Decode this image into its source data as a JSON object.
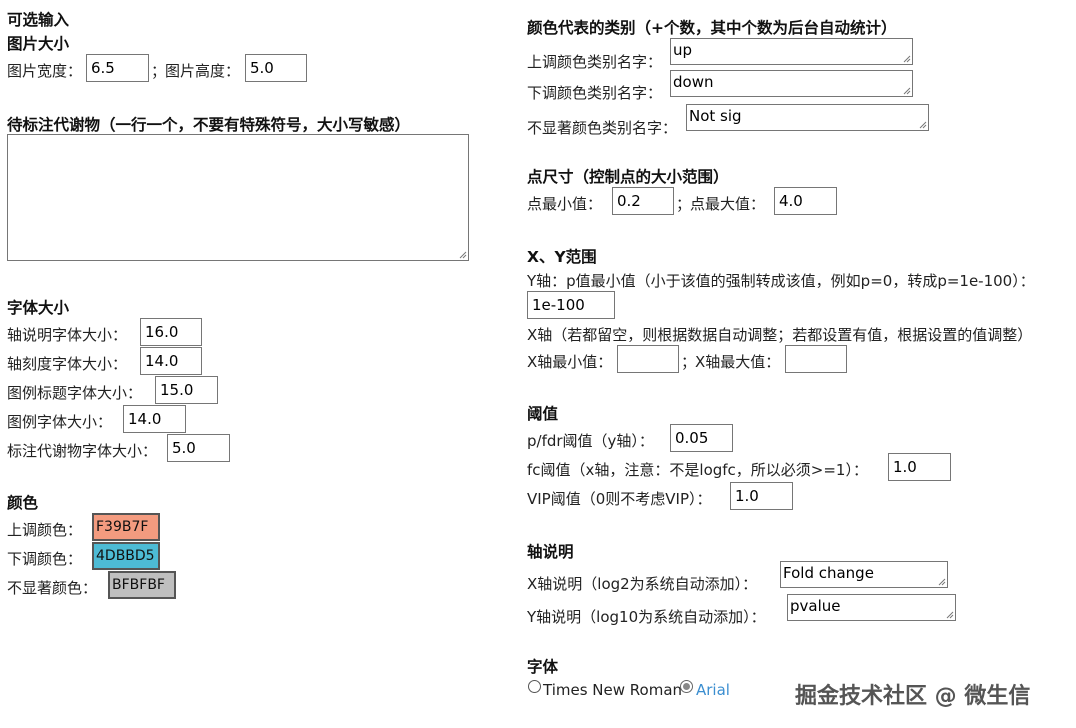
{
  "left": {
    "optional_title": "可选输入",
    "image_size": {
      "title": "图片大小",
      "width_label": "图片宽度：",
      "width_value": "6.5",
      "separator": "；",
      "height_label": "图片高度：",
      "height_value": "5.0"
    },
    "metabolites": {
      "title": "待标注代谢物（一行一个，不要有特殊符号，大小写敏感）",
      "value": ""
    },
    "font_size": {
      "title": "字体大小",
      "items": [
        {
          "label": "轴说明字体大小：",
          "value": "16.0"
        },
        {
          "label": "轴刻度字体大小：",
          "value": "14.0"
        },
        {
          "label": "图例标题字体大小：",
          "value": "15.0"
        },
        {
          "label": "图例字体大小：",
          "value": "14.0"
        },
        {
          "label": "标注代谢物字体大小：",
          "value": "5.0"
        }
      ]
    },
    "colors": {
      "title": "颜色",
      "items": [
        {
          "label": "上调颜色：",
          "value": "F39B7F",
          "color": "#F39B7F"
        },
        {
          "label": "下调颜色：",
          "value": "4DBBD5",
          "color": "#4DBBD5"
        },
        {
          "label": "不显著颜色：",
          "value": "BFBFBF",
          "color": "#BFBFBF"
        }
      ]
    }
  },
  "right": {
    "category": {
      "title": "颜色代表的类别（+个数，其中个数为后台自动统计）",
      "items": [
        {
          "label": "上调颜色类别名字：",
          "value": "up"
        },
        {
          "label": "下调颜色类别名字：",
          "value": "down"
        },
        {
          "label": "不显著颜色类别名字：",
          "value": "Not sig"
        }
      ]
    },
    "point_size": {
      "title": "点尺寸（控制点的大小范围）",
      "min_label": "点最小值：",
      "min_value": "0.2",
      "separator": "；",
      "max_label": "点最大值：",
      "max_value": "4.0"
    },
    "xy_range": {
      "title": "X、Y范围",
      "y_desc": "Y轴：p值最小值（小于该值的强制转成该值，例如p=0，转成p=1e-100）：",
      "y_value": "1e-100",
      "x_desc": "X轴（若都留空，则根据数据自动调整；若都设置有值，根据设置的值调整）",
      "x_min_label": "X轴最小值：",
      "x_min_value": "",
      "separator": "；",
      "x_max_label": "X轴最大值：",
      "x_max_value": ""
    },
    "threshold": {
      "title": "阈值",
      "p_label": "p/fdr阈值（y轴）：",
      "p_value": "0.05",
      "fc_label": "fc阈值（x轴，注意：不是logfc，所以必须>=1）：",
      "fc_value": "1.0",
      "vip_label": "VIP阈值（0则不考虑VIP）：",
      "vip_value": "1.0"
    },
    "axis_desc": {
      "title": "轴说明",
      "x_label": "X轴说明（log2为系统自动添加）：",
      "x_value": "Fold change",
      "y_label": "Y轴说明（log10为系统自动添加）：",
      "y_value": "pvalue"
    },
    "font": {
      "title": "字体",
      "options": [
        {
          "label": "Times New Roman",
          "checked": false
        },
        {
          "label": "Arial",
          "checked": true
        }
      ],
      "selected_color": "#3b8ed0"
    }
  },
  "watermark": "掘金技术社区 @ 微生信"
}
